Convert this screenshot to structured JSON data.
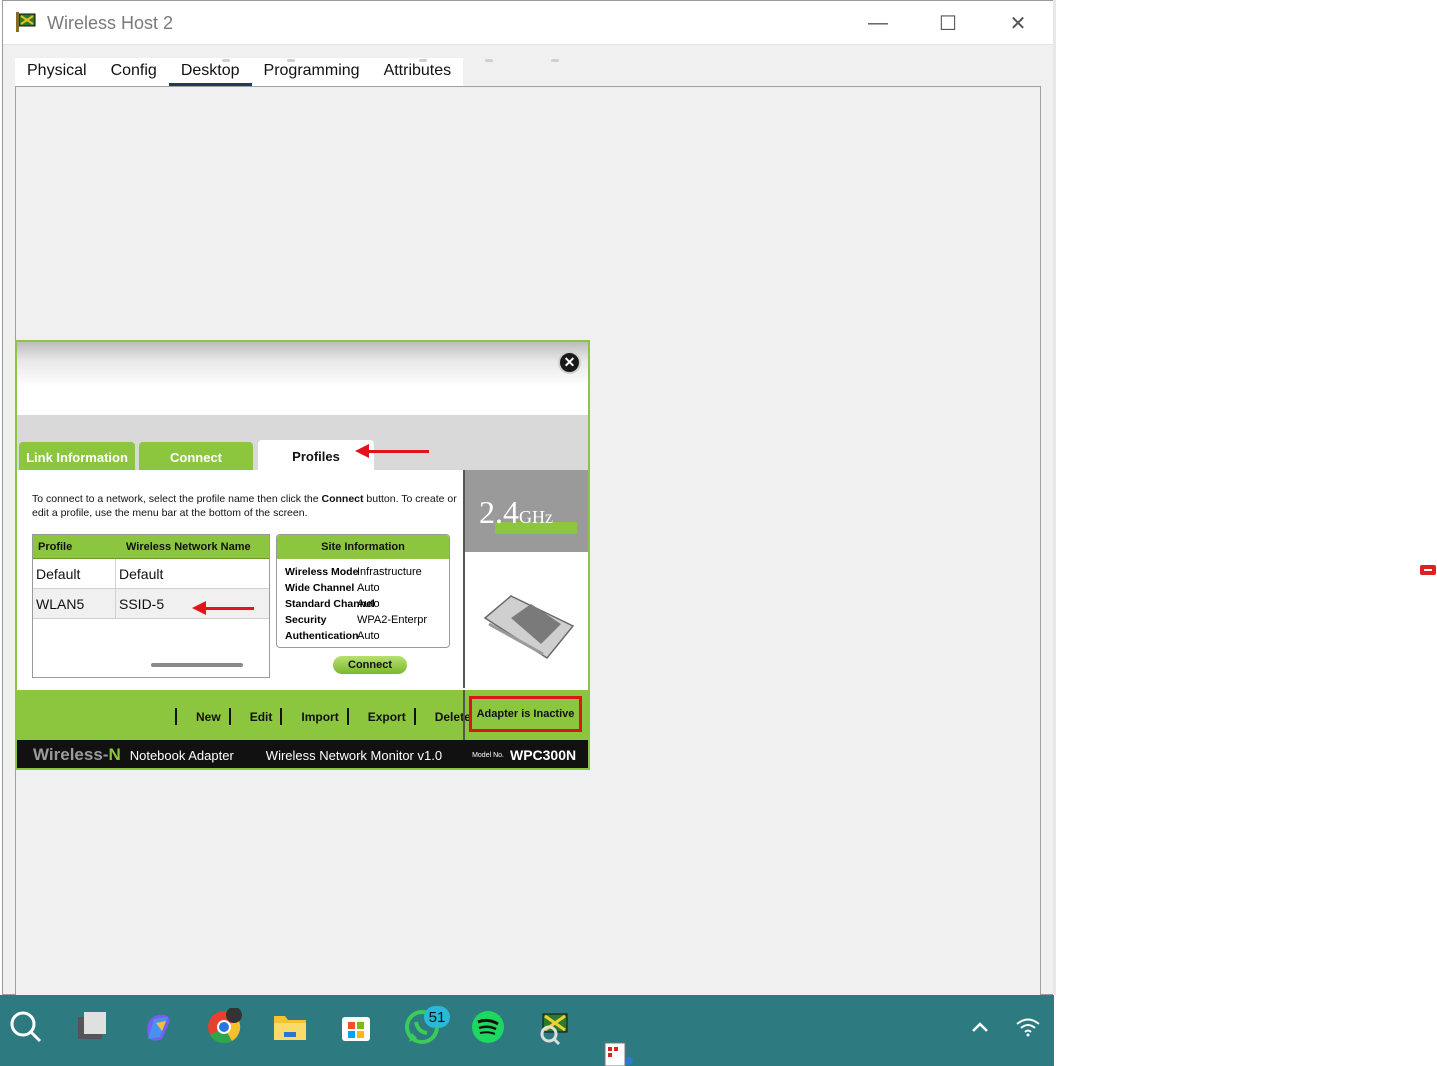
{
  "window": {
    "title": "Wireless Host 2",
    "controls": {
      "minimize": "—",
      "maximize": "☐",
      "close": "✕"
    }
  },
  "tabs": [
    {
      "label": "Physical"
    },
    {
      "label": "Config"
    },
    {
      "label": "Desktop",
      "active": true
    },
    {
      "label": "Programming"
    },
    {
      "label": "Attributes"
    }
  ],
  "dialog": {
    "tabs": {
      "link_info": "Link Information",
      "connect": "Connect",
      "profiles": "Profiles"
    },
    "instructions_pre": "To connect to a network, select the profile name then click the ",
    "instructions_bold": "Connect",
    "instructions_post": " button. To create or edit a profile, use the menu bar at the bottom of the screen.",
    "profile_table": {
      "headers": [
        "Profile",
        "Wireless Network Name"
      ],
      "rows": [
        {
          "profile": "Default",
          "ssid": "Default"
        },
        {
          "profile": "WLAN5",
          "ssid": "SSID-5"
        }
      ]
    },
    "site_info": {
      "title": "Site Information",
      "rows": [
        {
          "label": "Wireless Mode",
          "value": "Infrastructure"
        },
        {
          "label": "Wide Channel",
          "value": "Auto"
        },
        {
          "label": "Standard Channel",
          "value": "Auto"
        },
        {
          "label": "Security",
          "value": "WPA2-Enterpr"
        },
        {
          "label": "Authentication",
          "value": "Auto"
        }
      ]
    },
    "connect_button": "Connect",
    "band": {
      "number": "2.4",
      "unit": "GHz"
    },
    "menu_buttons": [
      "New",
      "Edit",
      "Import",
      "Export",
      "Delete"
    ],
    "adapter_status": "Adapter is Inactive",
    "footer": {
      "brand_a": "Wireless-",
      "brand_b": "N",
      "adapter": "Notebook Adapter",
      "monitor": "Wireless Network Monitor  v1.0",
      "model_label": "Model No.",
      "model": "WPC300N"
    }
  },
  "taskbar": {
    "whatsapp_badge": "51",
    "icons": [
      "search-icon",
      "task-view-icon",
      "copilot-icon",
      "chrome-icon",
      "file-explorer-icon",
      "store-icon",
      "whatsapp-icon",
      "spotify-icon",
      "packet-tracer-icon"
    ],
    "tray": [
      "chevron-up-icon",
      "wifi-icon"
    ]
  },
  "colors": {
    "linksys_green": "#8cc63f",
    "alert_red": "#e2141b",
    "taskbar": "#2d7a80"
  }
}
